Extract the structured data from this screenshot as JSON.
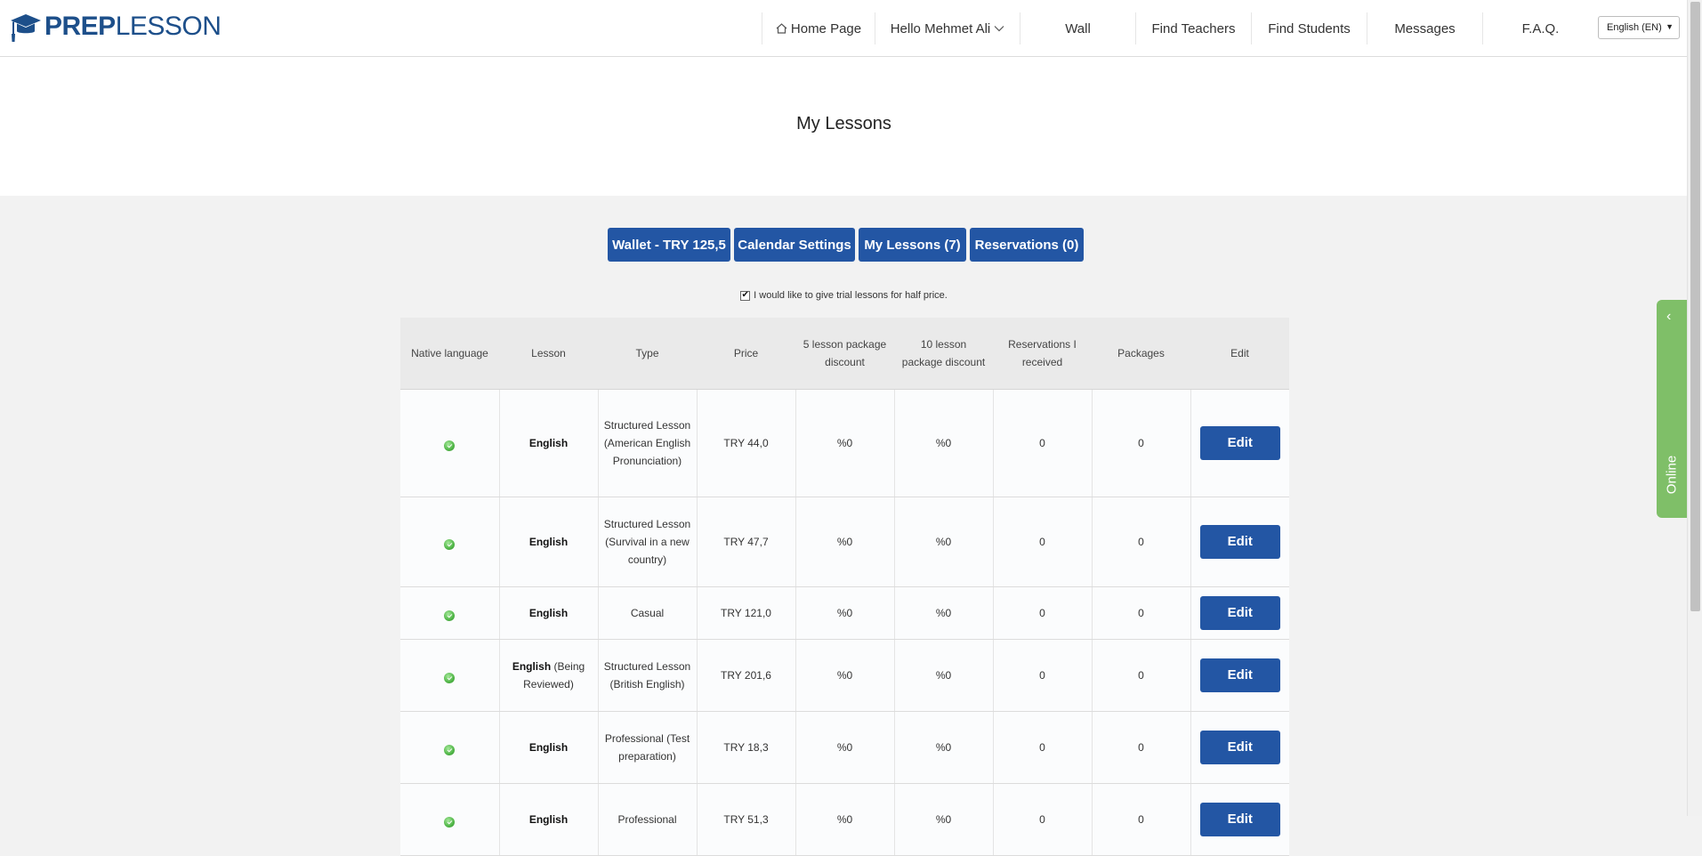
{
  "brand": {
    "prep": "PREP",
    "lesson": "LESSON",
    "color": "#1d4f8a"
  },
  "nav": {
    "home": "Home Page",
    "user": "Hello Mehmet Ali",
    "wall": "Wall",
    "find_teachers": "Find Teachers",
    "find_students": "Find Students",
    "messages": "Messages",
    "faq": "F.A.Q."
  },
  "language": {
    "selected": "English (EN)"
  },
  "page": {
    "title": "My Lessons"
  },
  "tabs": {
    "wallet": "Wallet - TRY 125,5",
    "calendar": "Calendar Settings",
    "lessons": "My Lessons (7)",
    "reservations": "Reservations (0)"
  },
  "trial": {
    "label": "I would like to give trial lessons for half price.",
    "checked": true
  },
  "table": {
    "headers": {
      "native": "Native language",
      "lesson": "Lesson",
      "type": "Type",
      "price": "Price",
      "disc5": "5 lesson package discount",
      "disc10": "10 lesson package discount",
      "reserv": "Reservations I received",
      "packages": "Packages",
      "edit": "Edit"
    },
    "rows": [
      {
        "lesson": "English",
        "note": "",
        "type": "Structured Lesson (American English Pronunciation)",
        "price": "TRY 44,0",
        "d5": "%0",
        "d10": "%0",
        "res": "0",
        "pkg": "0",
        "edit": "Edit"
      },
      {
        "lesson": "English",
        "note": "",
        "type": "Structured Lesson (Survival in a new country)",
        "price": "TRY 47,7",
        "d5": "%0",
        "d10": "%0",
        "res": "0",
        "pkg": "0",
        "edit": "Edit"
      },
      {
        "lesson": "English",
        "note": "",
        "type": "Casual",
        "price": "TRY 121,0",
        "d5": "%0",
        "d10": "%0",
        "res": "0",
        "pkg": "0",
        "edit": "Edit"
      },
      {
        "lesson": "English",
        "note": " (Being Reviewed)",
        "type": "Structured Lesson (British English)",
        "price": "TRY 201,6",
        "d5": "%0",
        "d10": "%0",
        "res": "0",
        "pkg": "0",
        "edit": "Edit"
      },
      {
        "lesson": "English",
        "note": "",
        "type": "Professional (Test preparation)",
        "price": "TRY 18,3",
        "d5": "%0",
        "d10": "%0",
        "res": "0",
        "pkg": "0",
        "edit": "Edit"
      },
      {
        "lesson": "English",
        "note": "",
        "type": "Professional",
        "price": "TRY 51,3",
        "d5": "%0",
        "d10": "%0",
        "res": "0",
        "pkg": "0",
        "edit": "Edit"
      }
    ]
  },
  "online": {
    "label": "Online"
  },
  "colors": {
    "primary": "#2356a4",
    "online": "#7fbf68"
  }
}
